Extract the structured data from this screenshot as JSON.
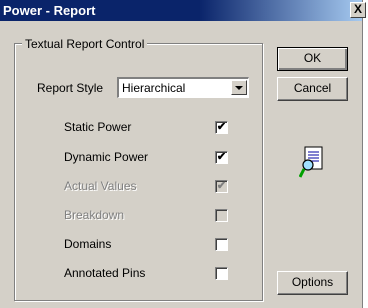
{
  "window": {
    "title": "Power - Report",
    "close_glyph": "X"
  },
  "group": {
    "legend": "Textual Report Control"
  },
  "report_style": {
    "label": "Report Style",
    "selected": "Hierarchical"
  },
  "options": [
    {
      "label": "Static Power",
      "checked": true,
      "enabled": true
    },
    {
      "label": "Dynamic Power",
      "checked": true,
      "enabled": true
    },
    {
      "label": "Actual Values",
      "checked": true,
      "enabled": false
    },
    {
      "label": "Breakdown",
      "checked": false,
      "enabled": false
    },
    {
      "label": "Domains",
      "checked": false,
      "enabled": true
    },
    {
      "label": "Annotated Pins",
      "checked": false,
      "enabled": true
    }
  ],
  "buttons": {
    "ok": "OK",
    "cancel": "Cancel",
    "options": "Options"
  },
  "icons": {
    "report": "report-search-icon"
  },
  "colors": {
    "titlebar": "#0a246a",
    "face": "#d4d0c8",
    "disabled_text": "#808080"
  }
}
